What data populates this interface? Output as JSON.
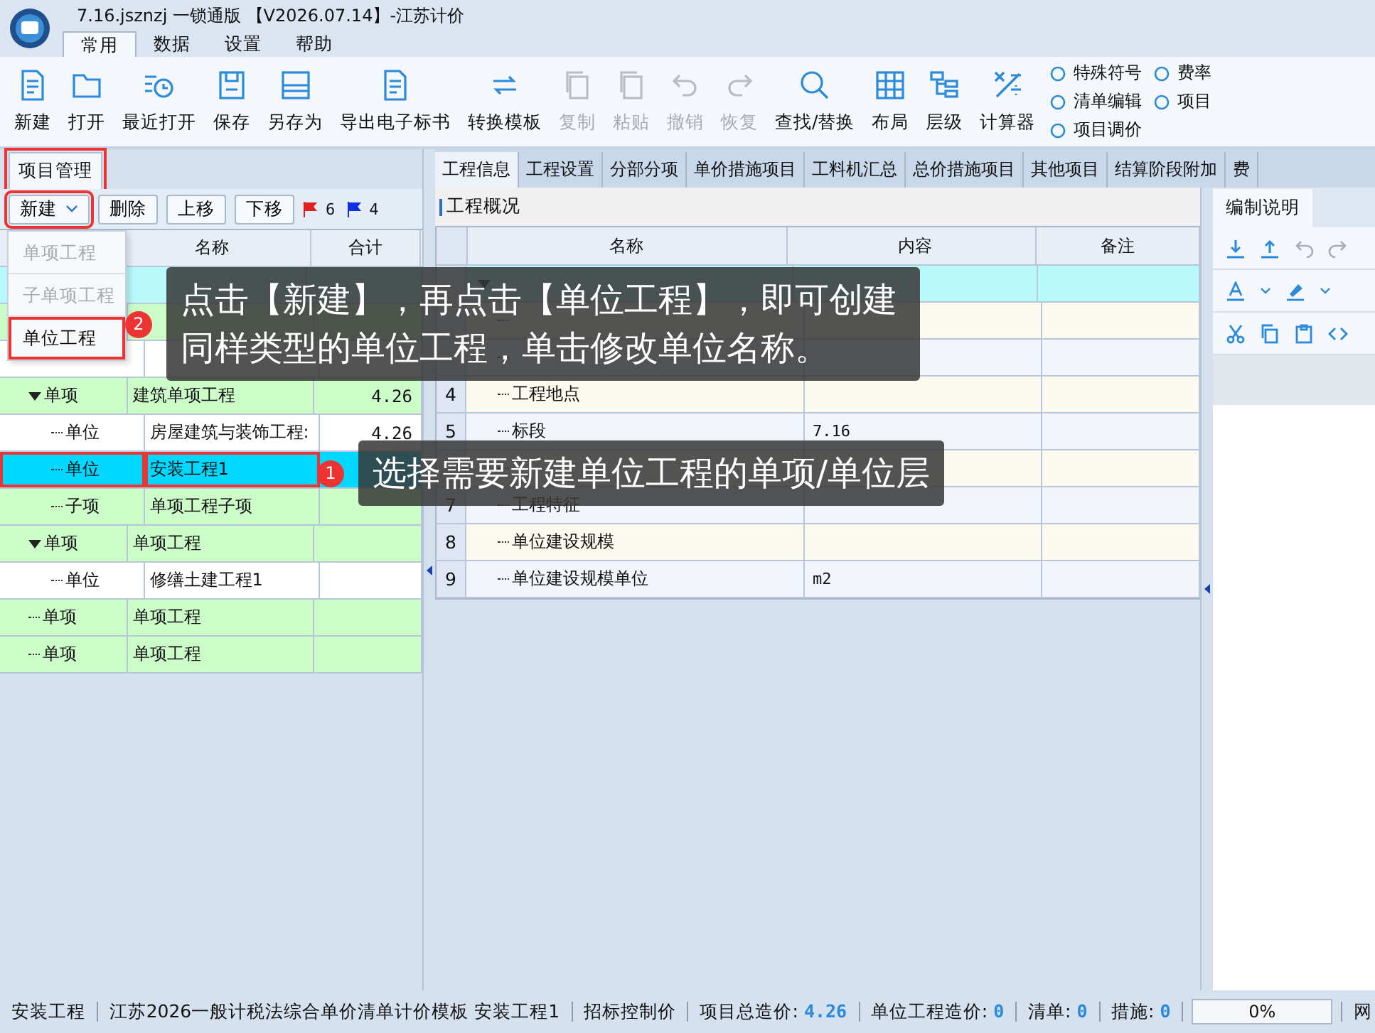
{
  "window": {
    "title": "7.16.jsznzj 一锁通版 【V2026.07.14】-江苏计价"
  },
  "menu_tabs": [
    {
      "label": "常用",
      "selected": true
    },
    {
      "label": "数据",
      "selected": false
    },
    {
      "label": "设置",
      "selected": false
    },
    {
      "label": "帮助",
      "selected": false
    }
  ],
  "ribbon": [
    {
      "label": "新建",
      "disabled": false
    },
    {
      "label": "打开",
      "disabled": false
    },
    {
      "label": "最近打开",
      "disabled": false
    },
    {
      "label": "保存",
      "disabled": false
    },
    {
      "label": "另存为",
      "disabled": false
    },
    {
      "label": "导出电子标书",
      "disabled": false
    },
    {
      "label": "转换模板",
      "disabled": false
    },
    {
      "label": "复制",
      "disabled": true
    },
    {
      "label": "粘贴",
      "disabled": true
    },
    {
      "label": "撤销",
      "disabled": true
    },
    {
      "label": "恢复",
      "disabled": true
    },
    {
      "label": "查找/替换",
      "disabled": false
    },
    {
      "label": "布局",
      "disabled": false
    },
    {
      "label": "层级",
      "disabled": false
    },
    {
      "label": "计算器",
      "disabled": false
    }
  ],
  "ribbon_small": [
    {
      "label": "特殊符号"
    },
    {
      "label": "清单编辑"
    },
    {
      "label": "项目调价"
    },
    {
      "label": "费率"
    },
    {
      "label": "项目"
    }
  ],
  "left_panel": {
    "tab": "项目管理",
    "buttons": [
      "新建",
      "删除",
      "上移",
      "下移"
    ],
    "red_flag_count": "6",
    "blue_flag_count": "4",
    "columns": [
      "名称",
      "合计"
    ],
    "rows": [
      {
        "kind": "project",
        "selected": false,
        "children": [
          {
            "kind": "single",
            "selected": false,
            "children": [
              {
                "kind": "unit",
                "selected": false
              }
            ]
          },
          {
            "kind": "single",
            "type": "单项",
            "name": "建筑单项工程",
            "total": "4.26",
            "expanded": true,
            "selected": false,
            "children": [
              {
                "kind": "unit",
                "type": "单位",
                "name": "房屋建筑与装饰工程:",
                "total": "4.26",
                "selected": false
              },
              {
                "type": "单位",
                "name": "安装工程1",
                "selected": true
              },
              {
                "kind": "sub",
                "type": "子项",
                "name": "单项工程子项",
                "selected": false
              }
            ]
          },
          {
            "kind": "single",
            "type": "单项",
            "name": "单项工程",
            "expanded": true,
            "selected": false,
            "children": [
              {
                "kind": "unit",
                "type": "单位",
                "name": "修缮土建工程1",
                "selected": false
              }
            ]
          },
          {
            "kind": "single",
            "type": "单项",
            "name": "单项工程",
            "selected": false
          },
          {
            "kind": "single",
            "type": "单项",
            "name": "单项工程",
            "selected": false
          }
        ]
      }
    ],
    "new_menu": [
      {
        "label": "单项工程",
        "disabled": true
      },
      {
        "label": "子单项工程",
        "disabled": true
      },
      {
        "label": "单位工程",
        "disabled": false
      }
    ]
  },
  "main_tabs": [
    {
      "label": "工程信息",
      "selected": true
    },
    {
      "label": "工程设置",
      "selected": false
    },
    {
      "label": "分部分项",
      "selected": false
    },
    {
      "label": "单价措施项目",
      "selected": false
    },
    {
      "label": "工料机汇总",
      "selected": false
    },
    {
      "label": "总价措施项目",
      "selected": false
    },
    {
      "label": "其他项目",
      "selected": false
    },
    {
      "label": "结算阶段附加",
      "selected": false
    },
    {
      "label": "费",
      "selected": false
    }
  ],
  "info": {
    "section": "工程概况",
    "columns": [
      "名称",
      "内容",
      "备注"
    ],
    "rows": [
      {
        "selected": true,
        "children": [
          {
            "selected": false
          },
          {
            "selected": false
          },
          {
            "number": "4",
            "name": "工程地点",
            "selected": false
          },
          {
            "number": "5",
            "name": "标段",
            "content": "7.16",
            "selected": false
          },
          {
            "selected": false
          },
          {
            "number": "7",
            "name": "工程特征",
            "selected": false
          },
          {
            "number": "8",
            "name": "单位建设规模",
            "selected": false
          },
          {
            "number": "9",
            "name": "单位建设规模单位",
            "content": "m2",
            "selected": false
          }
        ]
      }
    ]
  },
  "side_panel": {
    "tab": "编制说明"
  },
  "annotations": [
    {
      "number": "2",
      "text": "点击【新建】，再点击【单位工程】，即可创建同样类型的单位工程，单击修改单位名称。"
    },
    {
      "number": "1",
      "text": "选择需要新建单位工程的单项/单位层"
    }
  ],
  "status_bar": {
    "items": [
      {
        "label": "安装工程"
      },
      {
        "label": "江苏2026一般计税法综合单价清单计价模板 安装工程1"
      },
      {
        "label": "招标控制价"
      },
      {
        "label": "项目总造价:",
        "value": "4.26"
      },
      {
        "label": "单位工程造价:",
        "value": "0"
      },
      {
        "label": "清单:",
        "value": "0"
      },
      {
        "label": "措施:",
        "value": "0"
      }
    ],
    "progress": {
      "level": 0,
      "reading": "0%"
    },
    "tail": "网"
  }
}
